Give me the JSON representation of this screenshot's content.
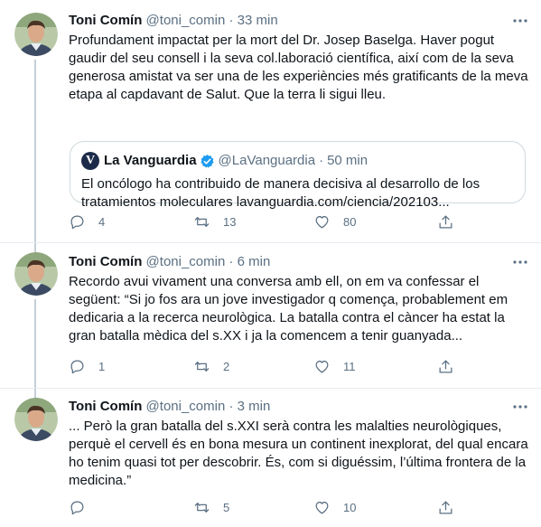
{
  "tweets": [
    {
      "name": "Toni Comín",
      "handle": "@toni_comin",
      "separator": "·",
      "time": "33 min",
      "text": "Profundament impactat per la mort del Dr. Josep Baselga. Haver pogut gaudir del seu consell i la seva col.laboració científica, així com de la seva generosa amistat va ser una de les experiències més gratificants de la meva etapa al capdavant de Salut. Que la terra li sigui lleu.",
      "quote": {
        "logo": "V",
        "name": "La Vanguardia",
        "handle": "@LaVanguardia",
        "separator": "·",
        "time": "50 min",
        "text": "El oncólogo ha contribuido de manera decisiva al desarrollo de los tratamientos moleculares lavanguardia.com/ciencia/202103..."
      },
      "replies": "4",
      "retweets": "13",
      "likes": "80"
    },
    {
      "name": "Toni Comín",
      "handle": "@toni_comin",
      "separator": "·",
      "time": "6 min",
      "text": "Recordo avui vivament una conversa amb ell, on em va confessar el següent: “Si jo fos ara un jove investigador q comença, probablement em dedicaria a la recerca neurològica. La batalla contra el càncer ha estat la gran batalla mèdica del s.XX i ja la comencem a tenir guanyada...",
      "replies": "1",
      "retweets": "2",
      "likes": "11"
    },
    {
      "name": "Toni Comín",
      "handle": "@toni_comin",
      "separator": "·",
      "time": "3 min",
      "text": "... Però la gran batalla del s.XXI serà contra les malalties neurològiques, perquè el cervell és en bona mesura un continent inexplorat, del qual encara ho tenim quasi tot per descobrir. És, com si diguéssim, l’última frontera de la medicina.”",
      "replies": "",
      "retweets": "5",
      "likes": "10"
    }
  ],
  "icons": {
    "more": "more-icon",
    "reply": "reply-icon",
    "retweet": "retweet-icon",
    "like": "like-icon",
    "share": "share-icon",
    "verified": "verified-badge-icon"
  },
  "colors": {
    "text": "#0f1419",
    "secondary": "#5b7083",
    "verified": "#1d9bf0",
    "divider": "#e6ecf0",
    "thread_line": "#c4cfd6"
  }
}
